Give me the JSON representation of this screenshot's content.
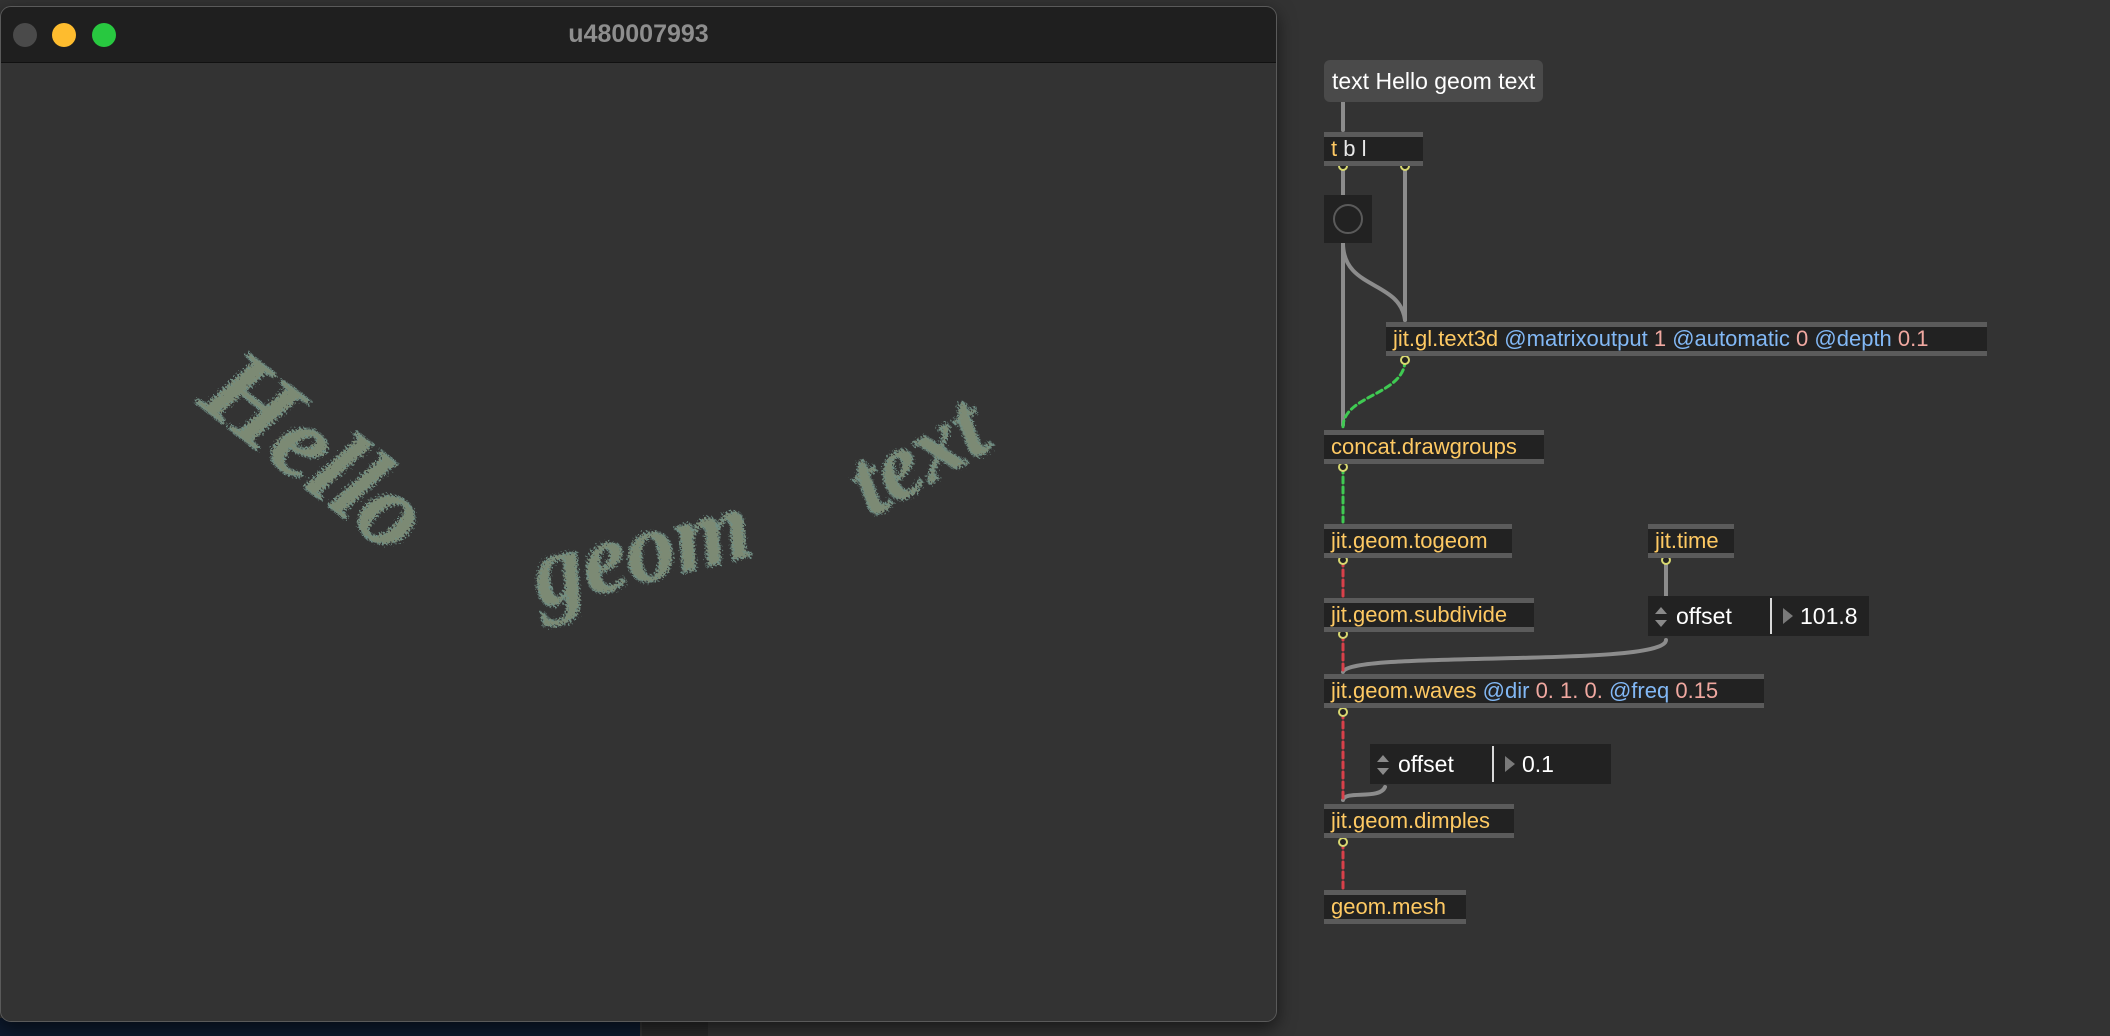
{
  "window": {
    "title": "u480007993"
  },
  "render": {
    "words": [
      "Hello",
      "geom",
      "text"
    ],
    "fill_color": "#8a9a80",
    "line_color": "#6f8f86"
  },
  "patch": {
    "message": "text Hello geom text",
    "trigger": {
      "name": "t",
      "args": "b l"
    },
    "text3d": {
      "name": "jit.gl.text3d",
      "a1": "@matrixoutput",
      "v1": "1",
      "a2": "@automatic",
      "v2": "0",
      "a3": "@depth",
      "v3": "0.1"
    },
    "concat": "concat.drawgroups",
    "togeom": "jit.geom.togeom",
    "time": "jit.time",
    "subdivide": "jit.geom.subdivide",
    "offset1": {
      "label": "offset",
      "value": "101.8"
    },
    "waves": {
      "name": "jit.geom.waves",
      "a1": "@dir",
      "v1": "0. 1. 0.",
      "a2": "@freq",
      "v2": "0.15"
    },
    "offset2": {
      "label": "offset",
      "value": "0.1"
    },
    "dimples": "jit.geom.dimples",
    "mesh": "geom.mesh"
  },
  "colors": {
    "object_text": "#fec963",
    "attribute_text": "#82b8f5",
    "number_text": "#f0a8a0",
    "geom_cord": "#d9404a",
    "matrix_cord": "#39c24a"
  }
}
